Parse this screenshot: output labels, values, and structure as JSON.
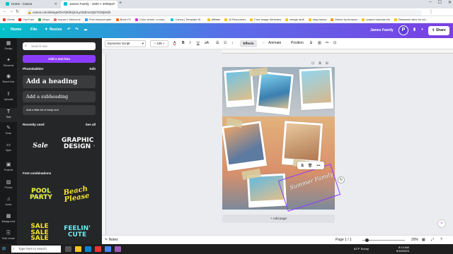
{
  "browser": {
    "tabs": [
      {
        "label": "Home - Canva",
        "active": false
      },
      {
        "label": "James Family - 1600 × 2000px",
        "active": true
      }
    ],
    "url": "canva.com/design/DAFjE0bQn/Ly2Zdmn2Q5TGWj/edit",
    "bookmarks": [
      "Gmail",
      "YouTube",
      "Maps",
      "Impact | Welcome",
      "Free teleprompter",
      "Boris FX",
      "Color wheel, a color...",
      "Canva | Template Di...",
      "affiliate",
      "AI Resources",
      "Free Image Websites",
      "design stuff",
      "drag tracks",
      "Merch by Amazon",
      "project tutorials etc",
      "Research sites for ad..."
    ]
  },
  "header": {
    "home": "Home",
    "file": "File",
    "resize": "Resize",
    "design_title": "James Family",
    "avatar_initial": "P",
    "share": "Share"
  },
  "rail": [
    {
      "icon": "▦",
      "label": "Design"
    },
    {
      "icon": "✦",
      "label": "Elements"
    },
    {
      "icon": "◉",
      "label": "Brand Hub"
    },
    {
      "icon": "⇪",
      "label": "Uploads"
    },
    {
      "icon": "T",
      "label": "Text"
    },
    {
      "icon": "✎",
      "label": "Draw"
    },
    {
      "icon": "⚏",
      "label": "Apps"
    },
    {
      "icon": "▣",
      "label": "Projects"
    },
    {
      "icon": "▨",
      "label": "Photos"
    },
    {
      "icon": "♫",
      "label": "Audio"
    },
    {
      "icon": "▩",
      "label": "Background"
    },
    {
      "icon": "⎘",
      "label": "Bulk create"
    }
  ],
  "panel": {
    "search_placeholder": "Search text",
    "add_textbox": "Add a text box",
    "brand_name": "PhotoDabbler",
    "edit": "Edit",
    "heading": "Add a heading",
    "subheading": "Add a subheading",
    "body": "Add a little bit of body text",
    "recently_used": "Recently used",
    "see_all": "See all",
    "recent_1": "Sale",
    "recent_2": "GRAPHIC DESIGN",
    "font_combinations": "Font combinations",
    "combo_1": "POOL PARTY",
    "combo_2": "Beach Please",
    "combo_3": "SALE SALE SALE",
    "combo_4": "FEELIN' CUTE"
  },
  "toolbar": {
    "font": "Eyesome Script",
    "size": "135",
    "effects": "Effects",
    "animate": "Animate",
    "position": "Position"
  },
  "canvas": {
    "handwriting": "Summer Family",
    "add_page": "+ Add page"
  },
  "footer": {
    "notes": "Notes",
    "page_indicator": "Page 1 / 1",
    "zoom": "20%",
    "zoom_level": 0.2
  },
  "taskbar": {
    "search_placeholder": "Type here to search",
    "weather": "81°F Sunny",
    "time": "8:14 AM",
    "date": "5/16/2023"
  },
  "colors": {
    "brand_purple": "#8b3dff",
    "header_start": "#03c2c9",
    "header_end": "#7b3fe4"
  }
}
